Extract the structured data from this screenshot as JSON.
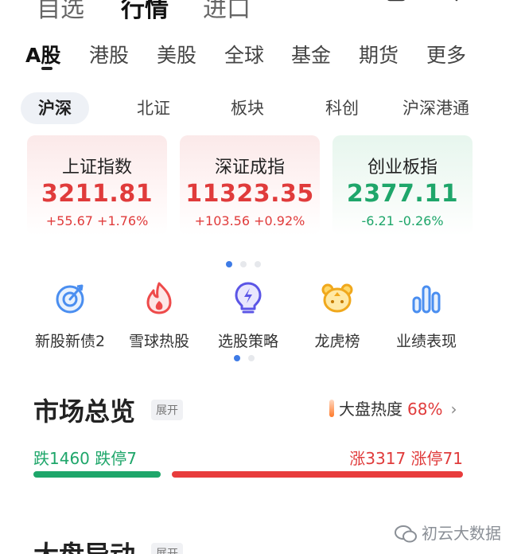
{
  "top_nav": {
    "items": [
      "自选",
      "行情",
      "进口"
    ],
    "active_index": 1
  },
  "market_tabs": {
    "items": [
      "A股",
      "港股",
      "美股",
      "全球",
      "基金",
      "期货",
      "更多"
    ],
    "active_index": 0
  },
  "sub_tabs": {
    "items": [
      "沪深",
      "北证",
      "板块",
      "科创",
      "沪深港通"
    ],
    "active_index": 0
  },
  "indices": [
    {
      "name": "上证指数",
      "value": "3211.81",
      "change": "+55.67 +1.76%",
      "trend": "up"
    },
    {
      "name": "深证成指",
      "value": "11323.35",
      "change": "+103.56 +0.92%",
      "trend": "up"
    },
    {
      "name": "创业板指",
      "value": "2377.11",
      "change": "-6.21 -0.26%",
      "trend": "down"
    }
  ],
  "features": [
    {
      "label": "新股新债2",
      "icon": "target-icon"
    },
    {
      "label": "雪球热股",
      "icon": "flame-icon"
    },
    {
      "label": "选股策略",
      "icon": "bulb-icon"
    },
    {
      "label": "龙虎榜",
      "icon": "tiger-icon"
    },
    {
      "label": "业绩表现",
      "icon": "bar-chart-icon"
    }
  ],
  "overview": {
    "title": "市场总览",
    "expand": "展开",
    "heat_label": "大盘热度",
    "heat_value": "68%",
    "down_text": "跌1460 跌停7",
    "up_text": "涨3317 涨停71",
    "down_count": 1460,
    "up_count": 3317
  },
  "movement": {
    "title": "大盘异动",
    "expand": "展开"
  },
  "watermark": "初云大数据",
  "colors": {
    "up": "#e03b3b",
    "down": "#1ea66a",
    "accent": "#3e7be6"
  }
}
